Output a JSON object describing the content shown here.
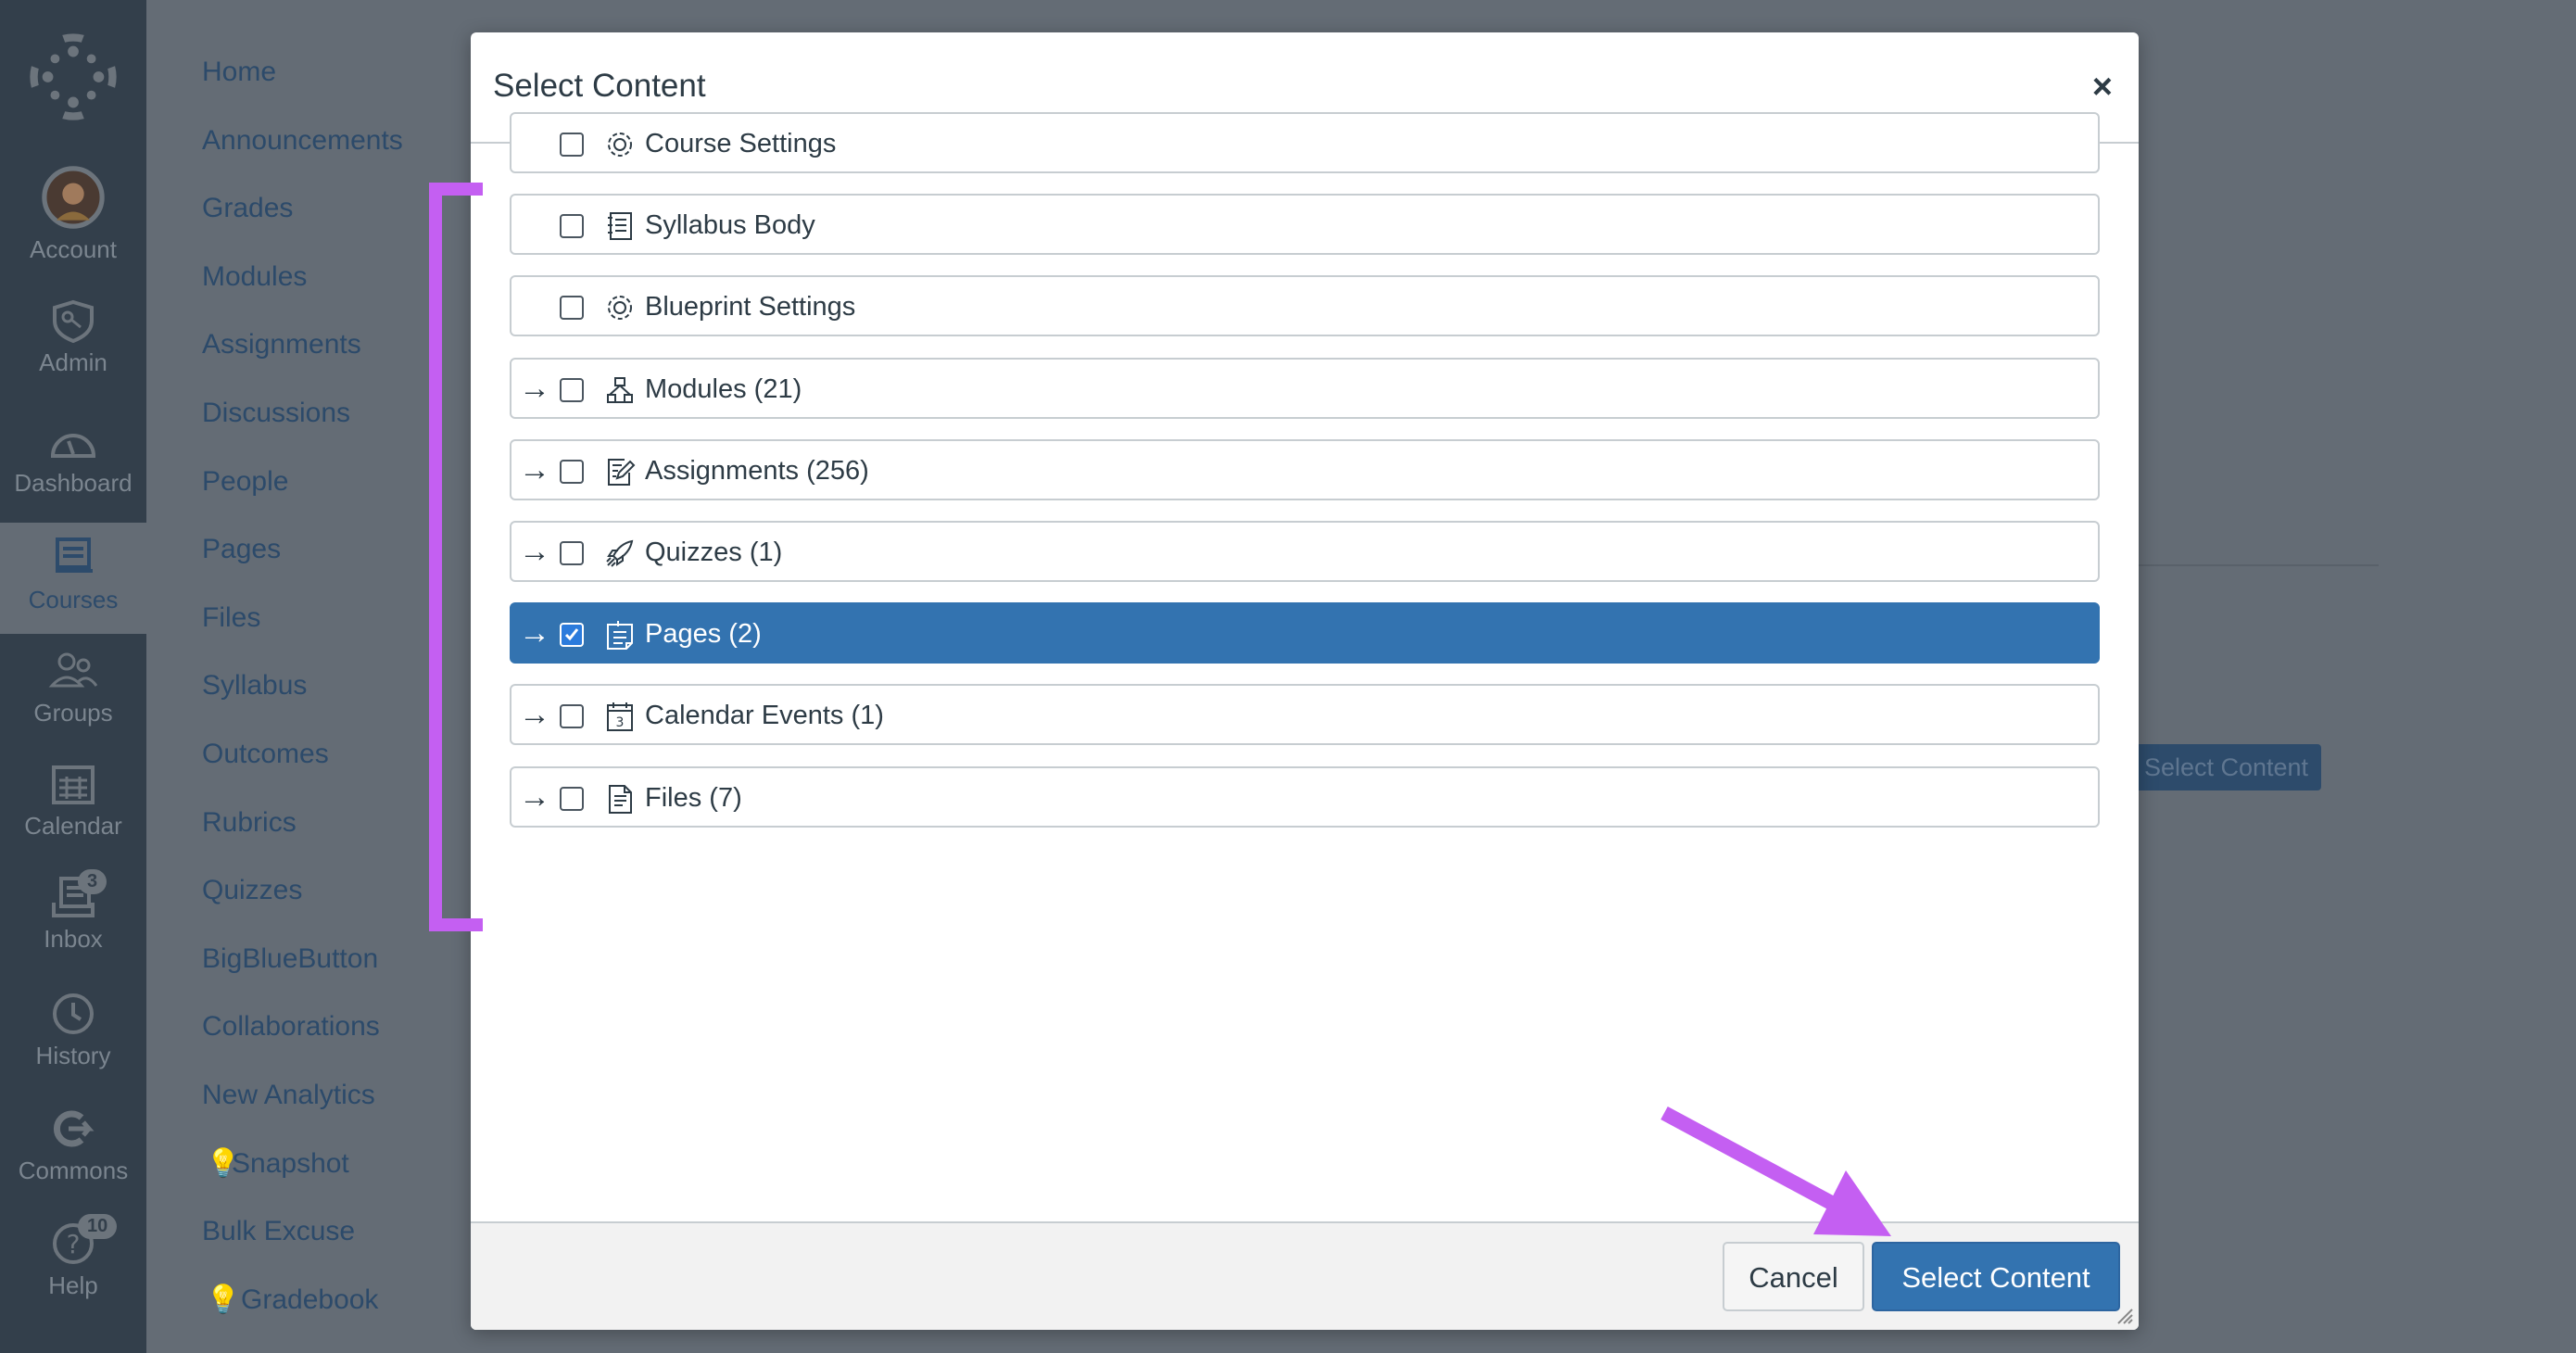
{
  "global_nav": {
    "items": [
      {
        "label": "Account",
        "icon": "avatar"
      },
      {
        "label": "Admin",
        "icon": "shield-key-icon"
      },
      {
        "label": "Dashboard",
        "icon": "speedometer-icon"
      },
      {
        "label": "Courses",
        "icon": "courses-icon",
        "active": true
      },
      {
        "label": "Groups",
        "icon": "groups-icon"
      },
      {
        "label": "Calendar",
        "icon": "calendar-icon"
      },
      {
        "label": "Inbox",
        "icon": "inbox-icon",
        "badge": "3"
      },
      {
        "label": "History",
        "icon": "clock-icon"
      },
      {
        "label": "Commons",
        "icon": "commons-icon"
      },
      {
        "label": "Help",
        "icon": "help-icon",
        "badge": "10"
      }
    ]
  },
  "course_nav": {
    "items": [
      "Home",
      "Announcements",
      "Grades",
      "Modules",
      "Assignments",
      "Discussions",
      "People",
      "Pages",
      "Files",
      "Syllabus",
      "Outcomes",
      "Rubrics",
      "Quizzes",
      "BigBlueButton",
      "Collaborations",
      "New Analytics",
      "Snapshot",
      "Bulk Excuse",
      "Gradebook"
    ]
  },
  "background": {
    "select_content_label": "Select Content"
  },
  "modal": {
    "title": "Select Content",
    "close_label": "×",
    "rows": [
      {
        "label": "Course Settings",
        "icon": "gear-icon",
        "expandable": false,
        "checked": false
      },
      {
        "label": "Syllabus Body",
        "icon": "syllabus-icon",
        "expandable": false,
        "checked": false
      },
      {
        "label": "Blueprint Settings",
        "icon": "gear-icon",
        "expandable": false,
        "checked": false
      },
      {
        "label": "Modules (21)",
        "icon": "modules-icon",
        "expandable": true,
        "checked": false
      },
      {
        "label": "Assignments (256)",
        "icon": "assignment-icon",
        "expandable": true,
        "checked": false
      },
      {
        "label": "Quizzes (1)",
        "icon": "rocket-icon",
        "expandable": true,
        "checked": false
      },
      {
        "label": "Pages (2)",
        "icon": "pages-icon",
        "expandable": true,
        "checked": true
      },
      {
        "label": "Calendar Events (1)",
        "icon": "calendar-icon",
        "expandable": true,
        "checked": false
      },
      {
        "label": "Files (7)",
        "icon": "file-icon",
        "expandable": true,
        "checked": false
      }
    ],
    "expand_glyph": "→",
    "cancel_label": "Cancel",
    "submit_label": "Select Content"
  },
  "colors": {
    "accent": "#3373b0",
    "annotation": "#c45ff2",
    "sidebar": "#333f4b"
  }
}
